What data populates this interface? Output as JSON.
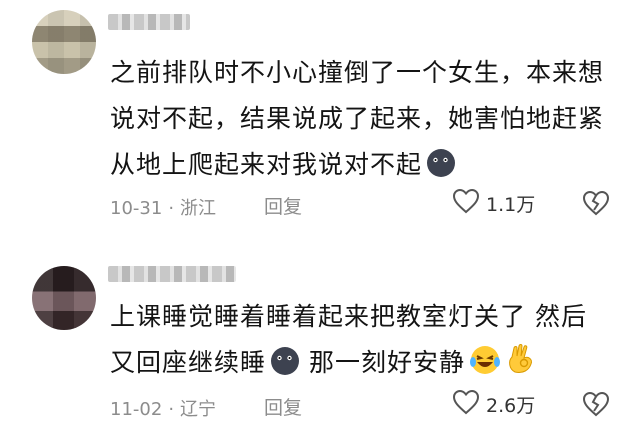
{
  "comments": [
    {
      "username": "",
      "text": "之前排队时不小心撞倒了一个女生，本来想说对不起，结果说成了起来，她害怕地赶紧从地上爬起来对我说对不起",
      "emojis": [
        "blackface-emoji"
      ],
      "date": "10-31",
      "location": "浙江",
      "reply_label": "回复",
      "likes": "1.1万"
    },
    {
      "username": "",
      "text": "上课睡觉睡着睡着起来把教室灯关了 然后又回座继续睡",
      "text_tail": "那一刻好安静",
      "emojis": [
        "blackface-emoji",
        "laughing-crying-emoji",
        "ok-hand-emoji"
      ],
      "date": "11-02",
      "location": "辽宁",
      "reply_label": "回复",
      "likes": "2.6万"
    }
  ],
  "colors": {
    "text": "#141414",
    "meta": "#8c8c8c"
  }
}
